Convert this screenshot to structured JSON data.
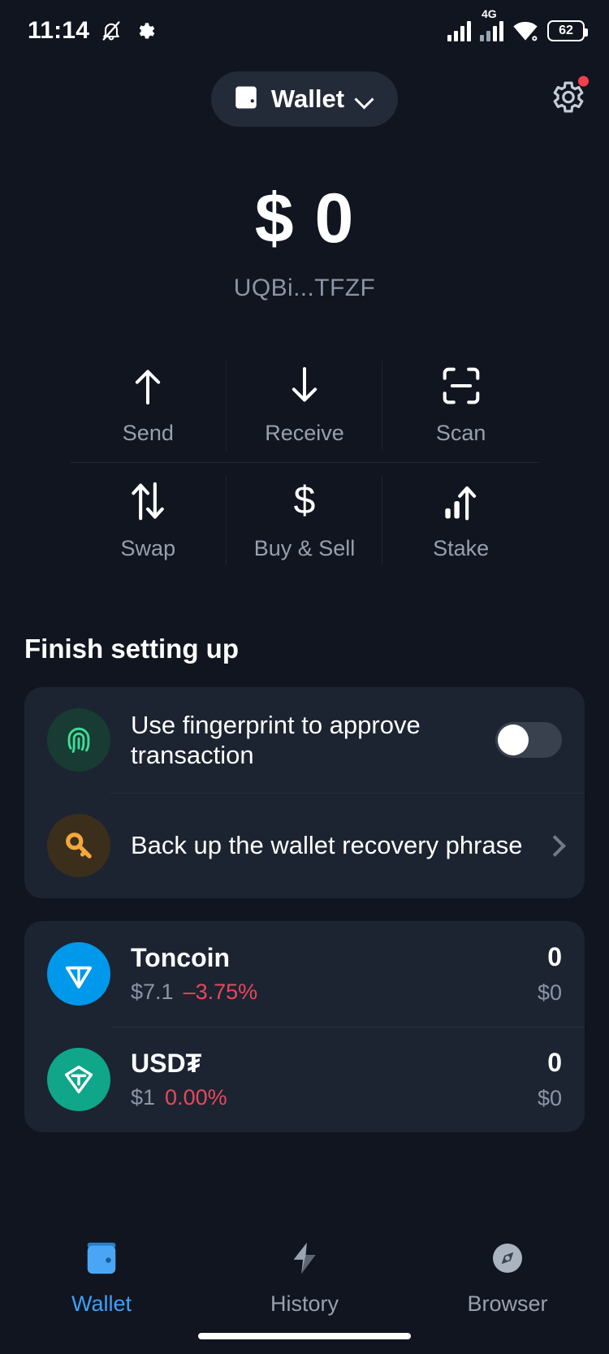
{
  "status_bar": {
    "time": "11:14",
    "icons": [
      "bell-muted-icon",
      "gear-icon"
    ],
    "network_label": "4G",
    "battery_level": "62",
    "right_icons": [
      "signal-bars-icon",
      "signal-bars-4g-icon",
      "wifi-icon",
      "battery-icon"
    ]
  },
  "header": {
    "wallet_chip_label": "Wallet",
    "wallet_icon": "wallet-icon",
    "chevron_icon": "chevron-down-icon",
    "settings_icon": "gear-icon",
    "has_notification_dot": true
  },
  "balance": {
    "amount": "$ 0",
    "address": "UQBi...TFZF"
  },
  "actions": [
    {
      "label": "Send",
      "icon": "arrow-up-icon"
    },
    {
      "label": "Receive",
      "icon": "arrow-down-icon"
    },
    {
      "label": "Scan",
      "icon": "scan-qr-icon"
    },
    {
      "label": "Swap",
      "icon": "swap-arrows-icon"
    },
    {
      "label": "Buy & Sell",
      "icon": "dollar-sign-icon"
    },
    {
      "label": "Stake",
      "icon": "chart-arrow-up-icon"
    }
  ],
  "setup": {
    "title": "Finish setting up",
    "items": [
      {
        "label": "Use fingerprint to approve transaction",
        "icon": "fingerprint-icon",
        "control": "toggle",
        "toggle_on": false
      },
      {
        "label": "Back up the wallet recovery phrase",
        "icon": "key-icon",
        "control": "chevron"
      }
    ]
  },
  "tokens": [
    {
      "name": "Toncoin",
      "icon": "toncoin-icon",
      "price": "$7.1",
      "change": "–3.75%",
      "change_color": "#e8485c",
      "amount": "0",
      "fiat": "$0"
    },
    {
      "name": "USD₮",
      "icon": "usdt-icon",
      "price": "$1",
      "change": "0.00%",
      "change_color": "#e8485c",
      "amount": "0",
      "fiat": "$0"
    }
  ],
  "bottom_nav": [
    {
      "label": "Wallet",
      "icon": "wallet-icon",
      "active": true
    },
    {
      "label": "History",
      "icon": "lightning-icon",
      "active": false
    },
    {
      "label": "Browser",
      "icon": "compass-icon",
      "active": false
    }
  ],
  "colors": {
    "background": "#101520",
    "card": "#1c2431",
    "accent": "#3fa0f5",
    "negative": "#e8485c"
  }
}
